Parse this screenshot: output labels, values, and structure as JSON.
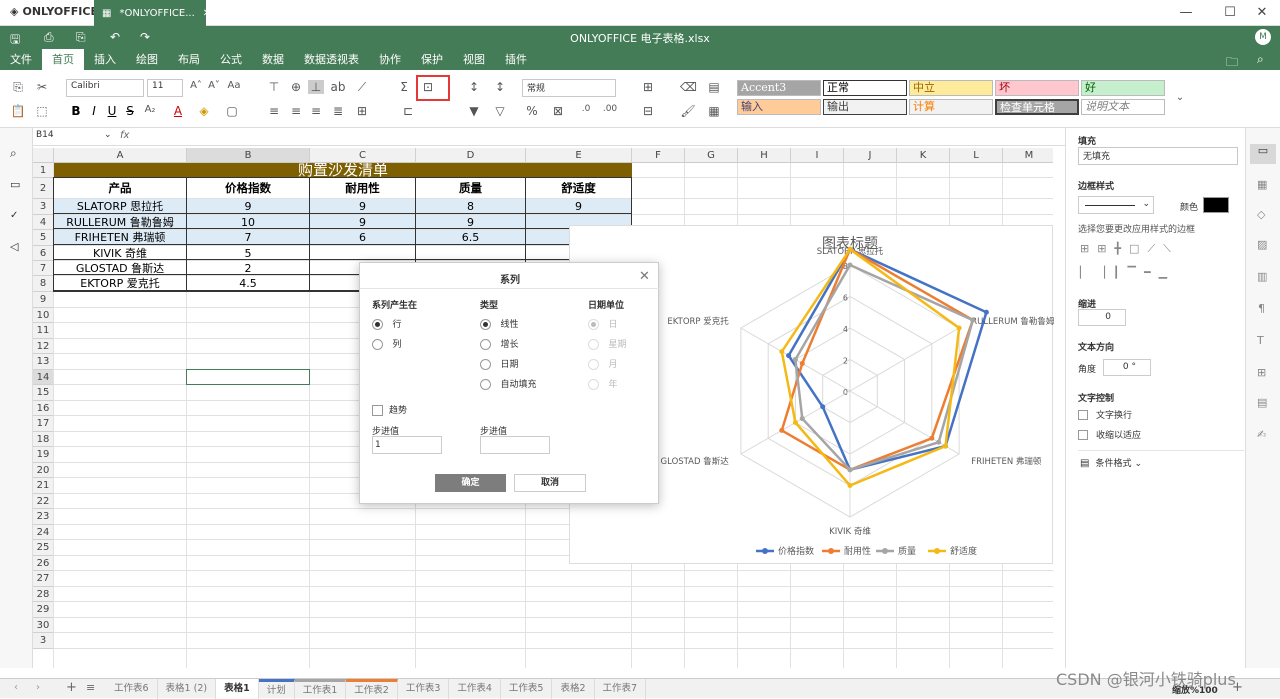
{
  "app": {
    "logo": "ONLYOFFICE",
    "tab_title": "*ONLYOFFICE...",
    "file_title": "ONLYOFFICE 电子表格.xlsx",
    "user_initial": "M"
  },
  "menu": [
    "文件",
    "首页",
    "插入",
    "绘图",
    "布局",
    "公式",
    "数据",
    "数据透视表",
    "协作",
    "保护",
    "视图",
    "插件"
  ],
  "menu_active": "首页",
  "toolbar": {
    "font": "Calibri",
    "size": "11",
    "number_format": "常规",
    "styles": [
      [
        "Accent3",
        "正常",
        "中立",
        "坏",
        "好"
      ],
      [
        "输入",
        "输出",
        "计算",
        "检查单元格",
        "说明文本"
      ]
    ]
  },
  "formula_bar": {
    "cell_ref": "B14",
    "fx": "fx",
    "value": ""
  },
  "columns": [
    "A",
    "B",
    "C",
    "D",
    "E",
    "F",
    "G",
    "H",
    "I",
    "J",
    "K",
    "L",
    "M"
  ],
  "rows": [
    "1",
    "2",
    "3",
    "4",
    "5",
    "6",
    "7",
    "8",
    "9",
    "10",
    "11",
    "12",
    "13",
    "14",
    "15",
    "16",
    "17",
    "18",
    "19",
    "20",
    "21",
    "22",
    "23",
    "24",
    "25",
    "26",
    "27",
    "28",
    "29",
    "30",
    "3"
  ],
  "sheet": {
    "title": "购置沙发清单",
    "headers": [
      "产品",
      "价格指数",
      "耐用性",
      "质量",
      "舒适度"
    ],
    "data": [
      [
        "SLATORP 思拉托",
        "9",
        "9",
        "8",
        "9"
      ],
      [
        "RULLERUM 鲁勒鲁姆",
        "10",
        "9",
        "9",
        ""
      ],
      [
        "FRIHETEN 弗瑞顿",
        "7",
        "6",
        "6.5",
        ""
      ],
      [
        "KIVIK 奇维",
        "5",
        "",
        "",
        ""
      ],
      [
        "GLOSTAD 鲁斯达",
        "2",
        "",
        "",
        ""
      ],
      [
        "EKTORP 爱克托",
        "4.5",
        "",
        "",
        ""
      ]
    ]
  },
  "chart": {
    "title": "图表标题",
    "categories": [
      "SLATORP 思拉托",
      "RULLERUM 鲁勒鲁姆",
      "FRIHETEN 弗瑞顿",
      "KIVIK 奇维",
      "GLOSTAD 鲁斯达",
      "EKTORP 爱克托"
    ],
    "ticks": [
      "0",
      "2",
      "4",
      "6",
      "8"
    ],
    "max": 8,
    "series": [
      {
        "name": "价格指数",
        "color": "#4472c4",
        "values": [
          9,
          10,
          7,
          5,
          2,
          4.5
        ]
      },
      {
        "name": "耐用性",
        "color": "#ed7d31",
        "values": [
          9,
          9,
          6,
          5,
          5,
          3.5
        ]
      },
      {
        "name": "质量",
        "color": "#a5a5a5",
        "values": [
          8,
          9,
          6.5,
          5,
          3.5,
          4
        ]
      },
      {
        "name": "舒适度",
        "color": "#f4b915",
        "values": [
          9,
          8,
          7,
          6,
          4,
          5
        ]
      }
    ]
  },
  "dialog": {
    "title": "系列",
    "group1": "系列产生在",
    "rows_opt": "行",
    "cols_opt": "列",
    "group2": "类型",
    "types": [
      "线性",
      "增长",
      "日期",
      "自动填充"
    ],
    "group3": "日期单位",
    "units": [
      "日",
      "星期",
      "月",
      "年"
    ],
    "trend": "趋势",
    "step_label": "步进值",
    "step_value": "1",
    "stop_label": "步进值",
    "ok": "确定",
    "cancel": "取消"
  },
  "right_panel": {
    "fill_label": "填充",
    "fill_value": "无填充",
    "border_label": "边框样式",
    "color_label": "颜色",
    "border_hint": "选择您要更改应用样式的边框",
    "indent_label": "缩进",
    "indent_value": "0",
    "text_dir_label": "文本方向",
    "angle_label": "角度",
    "angle_value": "0 °",
    "text_ctrl_label": "文字控制",
    "wrap": "文字换行",
    "shrink": "收缩以适应",
    "cond_format": "条件格式"
  },
  "sheets": [
    "工作表6",
    "表格1 (2)",
    "表格1",
    "计划",
    "工作表1",
    "工作表2",
    "工作表3",
    "工作表4",
    "工作表5",
    "表格2",
    "工作表7"
  ],
  "sheet_active": "表格1",
  "zoom": "缩放%100",
  "watermark": "CSDN @银河小铁骑plus"
}
